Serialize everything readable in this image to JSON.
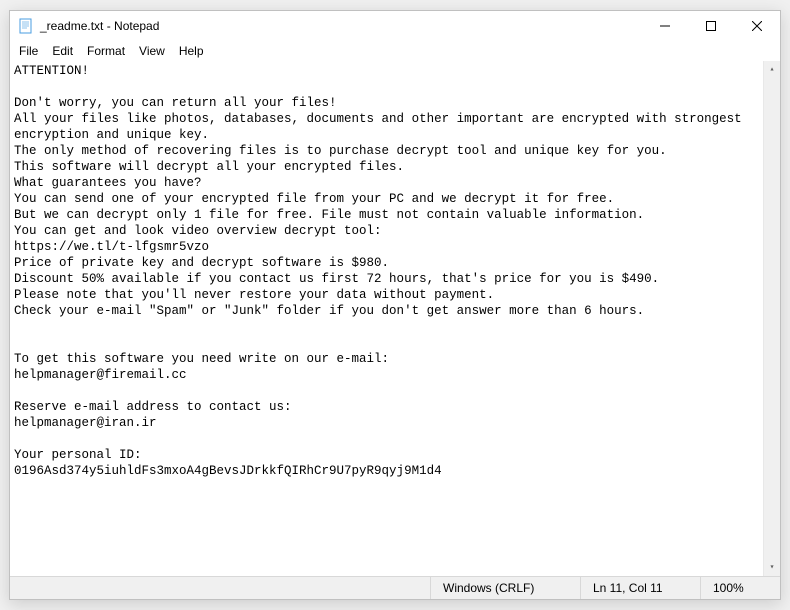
{
  "titlebar": {
    "title": "_readme.txt - Notepad"
  },
  "menubar": {
    "file": "File",
    "edit": "Edit",
    "format": "Format",
    "view": "View",
    "help": "Help"
  },
  "content": {
    "text": "ATTENTION!\n\nDon't worry, you can return all your files!\nAll your files like photos, databases, documents and other important are encrypted with strongest encryption and unique key.\nThe only method of recovering files is to purchase decrypt tool and unique key for you.\nThis software will decrypt all your encrypted files.\nWhat guarantees you have?\nYou can send one of your encrypted file from your PC and we decrypt it for free.\nBut we can decrypt only 1 file for free. File must not contain valuable information.\nYou can get and look video overview decrypt tool:\nhttps://we.tl/t-lfgsmr5vzo\nPrice of private key and decrypt software is $980.\nDiscount 50% available if you contact us first 72 hours, that's price for you is $490.\nPlease note that you'll never restore your data without payment.\nCheck your e-mail \"Spam\" or \"Junk\" folder if you don't get answer more than 6 hours.\n\n\nTo get this software you need write on our e-mail:\nhelpmanager@firemail.cc\n\nReserve e-mail address to contact us:\nhelpmanager@iran.ir\n\nYour personal ID:\n0196Asd374y5iuhldFs3mxoA4gBevsJDrkkfQIRhCr9U7pyR9qyj9M1d4"
  },
  "statusbar": {
    "encoding": "Windows (CRLF)",
    "position": "Ln 11, Col 11",
    "zoom": "100%"
  }
}
